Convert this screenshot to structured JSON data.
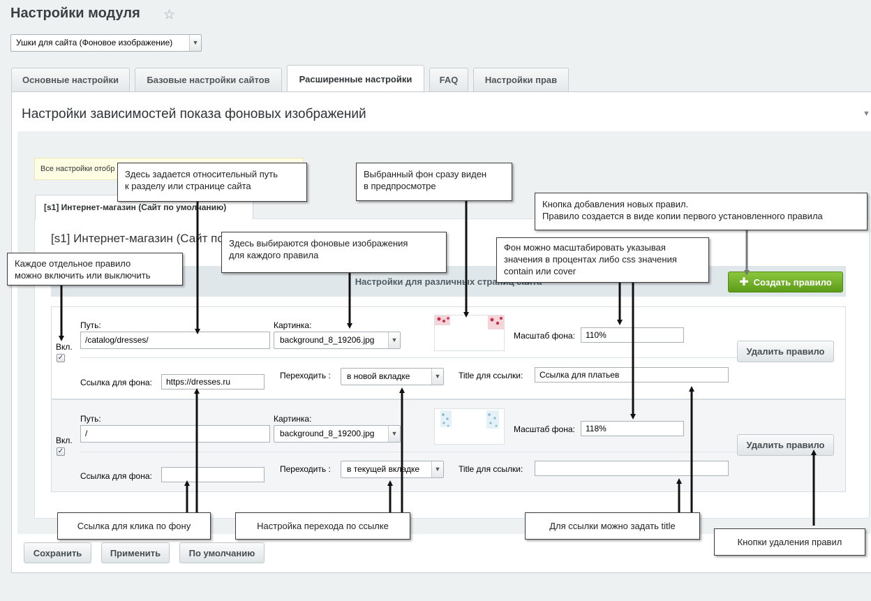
{
  "header": {
    "title": "Настройки модуля",
    "star_icon": "star-icon"
  },
  "module_select": {
    "value": "Ушки для сайта (Фоновое изображение)"
  },
  "tabs": [
    {
      "label": "Основные настройки",
      "active": false
    },
    {
      "label": "Базовые настройки сайтов",
      "active": false
    },
    {
      "label": "Расширенные настройки",
      "active": true
    },
    {
      "label": "FAQ",
      "active": false
    },
    {
      "label": "Настройки прав",
      "active": false
    }
  ],
  "panel": {
    "title": "Настройки зависимостей показа фоновых изображений"
  },
  "note": {
    "text": "Все настройки отобр"
  },
  "site_tab": {
    "label": "[s1] Интернет-магазин (Сайт по умолчанию)"
  },
  "site_title": "[s1] Интернет-магазин (Сайт по умолчанию)",
  "section": {
    "title": "Настройки для различных страниц сайта"
  },
  "create_button": {
    "label": "Создать правило"
  },
  "rules": [
    {
      "enabled_label": "Вкл.",
      "enabled": true,
      "path_label": "Путь:",
      "path": "/catalog/dresses/",
      "image_label": "Картинка:",
      "image": "background_8_19206.jpg",
      "scale_label": "Масштаб фона:",
      "scale": "110%",
      "link_label": "Ссылка для фона:",
      "link": "https://dresses.ru",
      "goto_label": "Переходить :",
      "goto": "в новой вкладке",
      "title_label": "Title для ссылки:",
      "title": "Ссылка для платьев",
      "delete_label": "Удалить правило",
      "thumb_color": "#c8304a"
    },
    {
      "enabled_label": "Вкл.",
      "enabled": true,
      "path_label": "Путь:",
      "path": "/",
      "image_label": "Картинка:",
      "image": "background_8_19200.jpg",
      "scale_label": "Масштаб фона:",
      "scale": "118%",
      "link_label": "Ссылка для фона:",
      "link": "",
      "goto_label": "Переходить :",
      "goto": "в текущей вкладке",
      "title_label": "Title для ссылки:",
      "title": "",
      "delete_label": "Удалить правило",
      "thumb_color": "#7fb6cf"
    }
  ],
  "footer": {
    "save": "Сохранить",
    "apply": "Применить",
    "default": "По умолчанию"
  },
  "callouts": {
    "path_line1": "Здесь задается относительный путь",
    "path_line2": "к разделу или странице сайта",
    "preview_line1": "Выбранный фон сразу виден",
    "preview_line2": "в предпросмотре",
    "create_line1": "Кнопка добавления новых правил.",
    "create_line2": "Правило создается в виде копии первого установленного правила",
    "image_line1": "Здесь выбираются фоновые изображения",
    "image_line2": "для каждого правила",
    "scale_line1": "Фон можно масштабировать указывая",
    "scale_line2": "значения в процентах либо css значения",
    "scale_line3": "contain или cover",
    "toggle_line1": "Каждое отдельное правило",
    "toggle_line2": "можно включить или выключить",
    "link": "Ссылка для клика по фону",
    "goto": "Настройка перехода по ссылке",
    "title": "Для ссылки можно задать title",
    "delete": "Кнопки удаления правил"
  },
  "colors": {
    "accent_green": "#6aa829",
    "panel_bg": "#eef1f2"
  }
}
